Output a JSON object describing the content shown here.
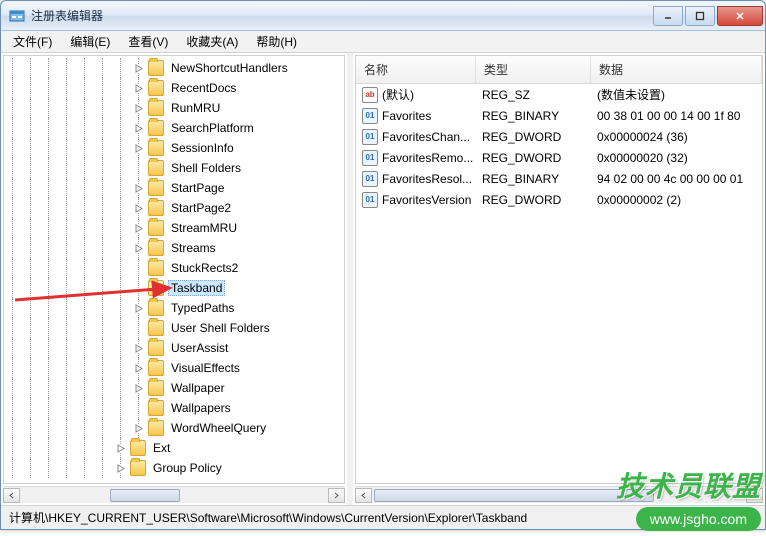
{
  "title": "注册表编辑器",
  "menu": [
    "文件(F)",
    "编辑(E)",
    "查看(V)",
    "收藏夹(A)",
    "帮助(H)"
  ],
  "tree": [
    {
      "depth": 7,
      "exp": "closed",
      "label": "NewShortcutHandlers"
    },
    {
      "depth": 7,
      "exp": "closed",
      "label": "RecentDocs"
    },
    {
      "depth": 7,
      "exp": "closed",
      "label": "RunMRU"
    },
    {
      "depth": 7,
      "exp": "closed",
      "label": "SearchPlatform"
    },
    {
      "depth": 7,
      "exp": "closed",
      "label": "SessionInfo"
    },
    {
      "depth": 7,
      "exp": "none",
      "label": "Shell Folders"
    },
    {
      "depth": 7,
      "exp": "closed",
      "label": "StartPage"
    },
    {
      "depth": 7,
      "exp": "closed",
      "label": "StartPage2"
    },
    {
      "depth": 7,
      "exp": "closed",
      "label": "StreamMRU"
    },
    {
      "depth": 7,
      "exp": "closed",
      "label": "Streams"
    },
    {
      "depth": 7,
      "exp": "none",
      "label": "StuckRects2"
    },
    {
      "depth": 7,
      "exp": "none",
      "label": "Taskband",
      "selected": true,
      "open": true
    },
    {
      "depth": 7,
      "exp": "closed",
      "label": "TypedPaths"
    },
    {
      "depth": 7,
      "exp": "none",
      "label": "User Shell Folders"
    },
    {
      "depth": 7,
      "exp": "closed",
      "label": "UserAssist"
    },
    {
      "depth": 7,
      "exp": "closed",
      "label": "VisualEffects"
    },
    {
      "depth": 7,
      "exp": "closed",
      "label": "Wallpaper"
    },
    {
      "depth": 7,
      "exp": "none",
      "label": "Wallpapers"
    },
    {
      "depth": 7,
      "exp": "closed",
      "label": "WordWheelQuery"
    },
    {
      "depth": 6,
      "exp": "closed",
      "label": "Ext"
    },
    {
      "depth": 6,
      "exp": "closed",
      "label": "Group Policy"
    }
  ],
  "columns": {
    "name": "名称",
    "type": "类型",
    "data": "数据"
  },
  "values": [
    {
      "icon": "str",
      "name": "(默认)",
      "type": "REG_SZ",
      "data": "(数值未设置)"
    },
    {
      "icon": "bin",
      "name": "Favorites",
      "type": "REG_BINARY",
      "data": "00 38 01 00 00 14 00 1f 80"
    },
    {
      "icon": "bin",
      "name": "FavoritesChan...",
      "type": "REG_DWORD",
      "data": "0x00000024 (36)"
    },
    {
      "icon": "bin",
      "name": "FavoritesRemo...",
      "type": "REG_DWORD",
      "data": "0x00000020 (32)"
    },
    {
      "icon": "bin",
      "name": "FavoritesResol...",
      "type": "REG_BINARY",
      "data": "94 02 00 00 4c 00 00 00 01"
    },
    {
      "icon": "bin",
      "name": "FavoritesVersion",
      "type": "REG_DWORD",
      "data": "0x00000002 (2)"
    }
  ],
  "statusbar": "计算机\\HKEY_CURRENT_USER\\Software\\Microsoft\\Windows\\CurrentVersion\\Explorer\\Taskband",
  "watermark": {
    "text": "技术员联盟",
    "url": "www.jsgho.com"
  }
}
